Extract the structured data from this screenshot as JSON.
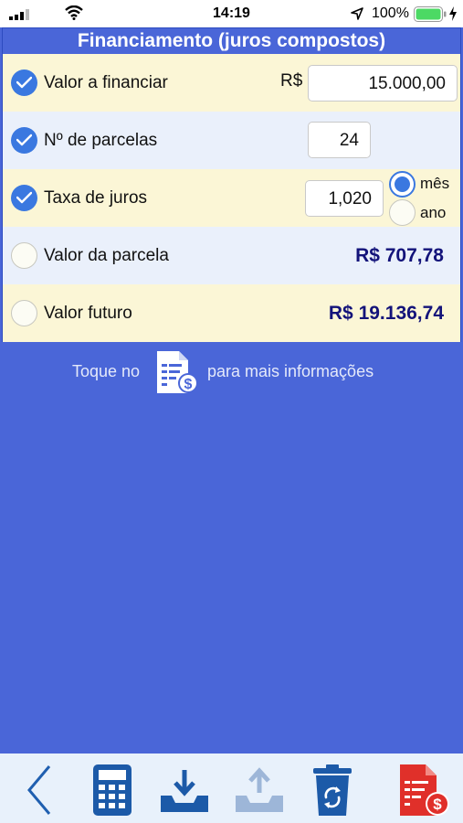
{
  "status_bar": {
    "time": "14:19",
    "battery": "100%"
  },
  "title": "Financiamento (juros compostos)",
  "rows": [
    {
      "label": "Valor a financiar",
      "checked": true,
      "currency": "R$",
      "value": "15.000,00"
    },
    {
      "label": "Nº de parcelas",
      "checked": true,
      "value": "24"
    },
    {
      "label": "Taxa de juros",
      "checked": true,
      "value": "1,020",
      "period_options": [
        "mês",
        "ano"
      ],
      "period_selected": "mês"
    },
    {
      "label": "Valor da parcela",
      "checked": false,
      "result": "R$ 707,78"
    },
    {
      "label": "Valor futuro",
      "checked": false,
      "result": "R$ 19.136,74"
    }
  ],
  "info": {
    "prefix": "Toque no",
    "suffix": "para mais informações"
  },
  "toolbar": {
    "items": [
      "back-icon",
      "calculator-icon",
      "download-tray-icon",
      "upload-tray-icon",
      "trash-recycle-icon",
      "document-dollar-icon"
    ]
  },
  "colors": {
    "background": "#4a66d8",
    "check": "#3a78e0",
    "result": "#13137a",
    "toolbar": "#e8f1fb",
    "doc_red": "#e0302a"
  }
}
